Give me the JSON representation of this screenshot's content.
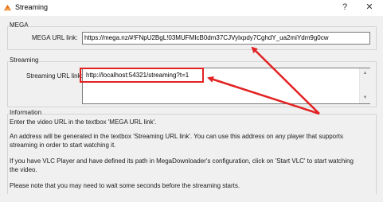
{
  "window": {
    "title": "Streaming",
    "help_label": "?",
    "close_label": "✕",
    "app_icon": "mega-icon"
  },
  "mega_group": {
    "legend": "MEGA",
    "url_label": "MEGA URL link:",
    "url_value": "https://mega.nz/#!FNpU2BgL!03MUFMIcB0dm37CJVylxpdy7CghdY_ua2miYdm9g0cw"
  },
  "streaming_group": {
    "legend": "Streaming",
    "url_label": "Streaming URL link:",
    "url_value": "http://localhost:54321/streaming?t=1"
  },
  "information": {
    "legend": "Information",
    "lines": [
      "Enter the video URL in the textbox 'MEGA URL link'.",
      "An address will be generated in the textbox 'Streaming URL link'. You can use this address on any player that supports",
      "streaming in order to start watching it.",
      "If you have VLC Player and have defined its path in MegaDownloader's configuration, click on 'Start VLC' to start watching",
      "the video.",
      "Please note that you may need to wait some seconds before the streaming starts."
    ]
  },
  "annotation": {
    "color": "#e22222"
  }
}
